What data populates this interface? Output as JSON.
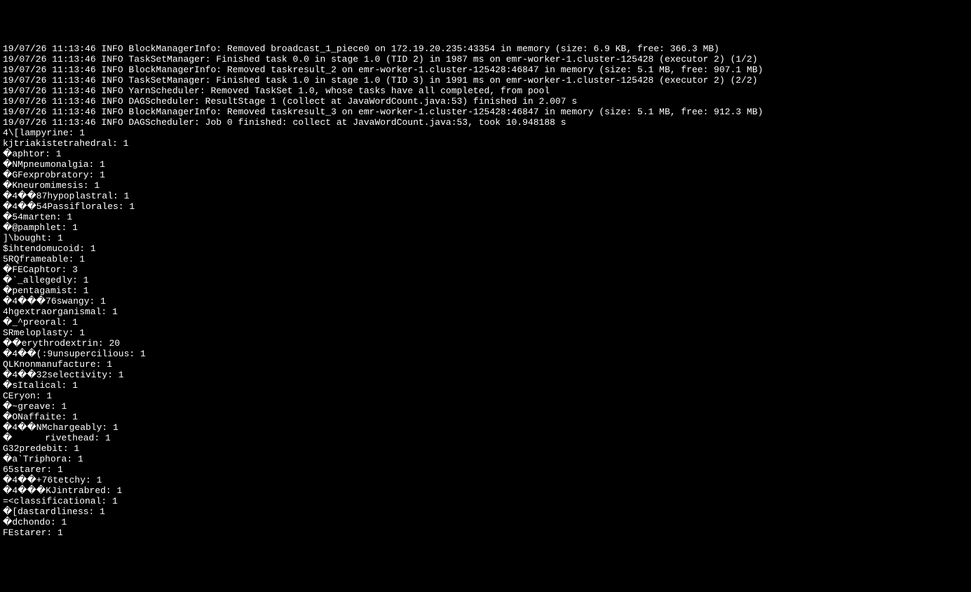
{
  "terminal": {
    "lines": [
      "19/07/26 11:13:46 INFO BlockManagerInfo: Removed broadcast_1_piece0 on 172.19.20.235:43354 in memory (size: 6.9 KB, free: 366.3 MB)",
      "19/07/26 11:13:46 INFO TaskSetManager: Finished task 0.0 in stage 1.0 (TID 2) in 1987 ms on emr-worker-1.cluster-125428 (executor 2) (1/2)",
      "19/07/26 11:13:46 INFO BlockManagerInfo: Removed taskresult_2 on emr-worker-1.cluster-125428:46847 in memory (size: 5.1 MB, free: 907.1 MB)",
      "19/07/26 11:13:46 INFO TaskSetManager: Finished task 1.0 in stage 1.0 (TID 3) in 1991 ms on emr-worker-1.cluster-125428 (executor 2) (2/2)",
      "19/07/26 11:13:46 INFO YarnScheduler: Removed TaskSet 1.0, whose tasks have all completed, from pool",
      "19/07/26 11:13:46 INFO DAGScheduler: ResultStage 1 (collect at JavaWordCount.java:53) finished in 2.007 s",
      "19/07/26 11:13:46 INFO BlockManagerInfo: Removed taskresult_3 on emr-worker-1.cluster-125428:46847 in memory (size: 5.1 MB, free: 912.3 MB)",
      "19/07/26 11:13:46 INFO DAGScheduler: Job 0 finished: collect at JavaWordCount.java:53, took 10.948188 s",
      "4\\[lampyrine: 1",
      "kjtriakistetrahedral: 1",
      "�aphtor: 1",
      "�NMpneumonalgia: 1",
      "�GFexprobratory: 1",
      "�Kneuromimesis: 1",
      "�4��87hypoplastral: 1",
      "�4��54Passiflorales: 1",
      "�54marten: 1",
      "�@pamphlet: 1",
      "]\\bought: 1",
      "$ihtendomucoid: 1",
      "5RQframeable: 1",
      "�FECaphtor: 3",
      "�`_allegedly: 1",
      "�pentagamist: 1",
      "�4���76swangy: 1",
      "4hgextraorganismal: 1",
      "�_^preoral: 1",
      "SRmeloplasty: 1",
      "��erythrodextrin: 20",
      "�4��(:9unsupercilious: 1",
      "QLKnonmanufacture: 1",
      "�4��32selectivity: 1",
      "�sItalical: 1",
      "CEryon: 1",
      "�~greave: 1",
      "�ONaffaite: 1",
      "�4��NMchargeably: 1",
      "�      rivethead: 1",
      "G32predebit: 1",
      "�a`Triphora: 1",
      "65starer: 1",
      "�4��+76tetchy: 1",
      "�4���KJintrabred: 1",
      "=<classificational: 1",
      "�[dastardliness: 1",
      "�dchondo: 1",
      "FEstarer: 1"
    ]
  }
}
